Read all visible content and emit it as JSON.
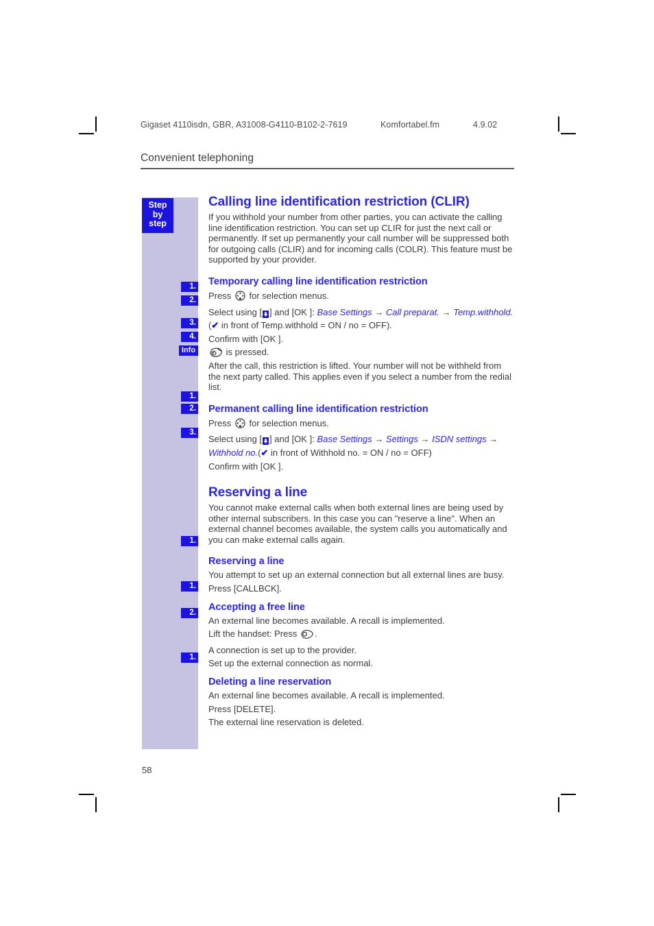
{
  "running_header": {
    "document": "Gigaset 4110isdn, GBR, A31008-G4110-B102-2-7619",
    "file": "Komfortabel.fm",
    "date": "4.9.02"
  },
  "chapter": {
    "title": "Convenient telephoning"
  },
  "sidebar": {
    "badge_line1": "Step",
    "badge_line2": "by",
    "badge_line3": "step",
    "markers": [
      "1.",
      "2.",
      "3.",
      "4.",
      "Info",
      "1.",
      "2.",
      "3.",
      "1.",
      "1.",
      "2.",
      "1."
    ]
  },
  "sections": [
    {
      "id": "clir",
      "heading": "Calling line identification restriction (CLIR)",
      "intro": "If you withhold your number from other parties, you can activate the calling line identification restriction. You can set up CLIR for just the next call or permanently. If set up permanently your call number will be suppressed both for outgoing calls (CLIR) and for incoming calls (COLR). This feature must be supported by your provider."
    },
    {
      "id": "temporary-clir",
      "heading": "Temporary calling line identification restriction",
      "step1_pre": "Press",
      "step1_post": "for selection menus.",
      "step2_pre": "Select using [",
      "step2_mid": "] and [OK ]:",
      "step2_path1": "Base Settings",
      "step2_path2": "Call preparat.",
      "step2_path3": "Temp.withhold.",
      "step2_note_pre": "(",
      "step2_note_post": " in front of Temp.withhold = ON / no = OFF).",
      "step3": "Confirm with [OK ].",
      "step4_post": "is pressed.",
      "info": "After the call, this restriction is lifted. Your number will not be withheld from the next party called. This applies even if you select a number from the redial list."
    },
    {
      "id": "permanent-clir",
      "heading": "Permanent calling line identification restriction",
      "step1_pre": "Press",
      "step1_post": "for selection menus.",
      "step2_pre": "Select using [",
      "step2_mid": "] and [OK ]:",
      "step2_path1": "Base Settings",
      "step2_path2": "Settings",
      "step2_path3": "ISDN settings",
      "step2_path4": "Withhold no.",
      "step2_note_pre": "(",
      "step2_note_post": " in front of Withhold no. = ON / no = OFF)",
      "step3": "Confirm with [OK ]."
    },
    {
      "id": "reserving-a-line",
      "heading": "Reserving a line",
      "intro": "You cannot make external calls when both external lines are being used by other internal subscribers. In this case you can \"reserve a line\". When an external channel becomes available, the system calls you automatically and you can make external calls again."
    },
    {
      "id": "reserving-a-line-sub",
      "heading": "Reserving a line",
      "line1": "You attempt to set up an external connection but all external lines are busy.",
      "line2": "Press [CALLBCK]."
    },
    {
      "id": "accepting-a-free-line",
      "heading": "Accepting a free line",
      "line1": "An external line becomes available. A recall is implemented.",
      "line2_pre": "Lift the handset: Press",
      "line2_post": ".",
      "line3": "A connection is set up to the provider.",
      "line4": "Set up the external connection as normal."
    },
    {
      "id": "deleting-a-line-reservation",
      "heading": "Deleting a line reservation",
      "line1": "An external line becomes available. A recall is implemented.",
      "line2": "Press [DELETE].",
      "line3": "The external line reservation is deleted."
    }
  ],
  "icons": {
    "navigation_key": "navigation-key-icon",
    "hangup_key": "hangup-key-icon",
    "talk_key": "talk-key-icon",
    "down_key": "down-arrow-key-icon",
    "checkmark": "checkmark-icon",
    "arrow_right": "right-arrow-icon"
  },
  "folio": {
    "page_number": "58"
  },
  "colors": {
    "accent_blue": "#2b25ee",
    "badge_blue": "#1b14e0",
    "sidebar_lavender": "#c6c2e2",
    "body_text": "#3a3a3a"
  }
}
